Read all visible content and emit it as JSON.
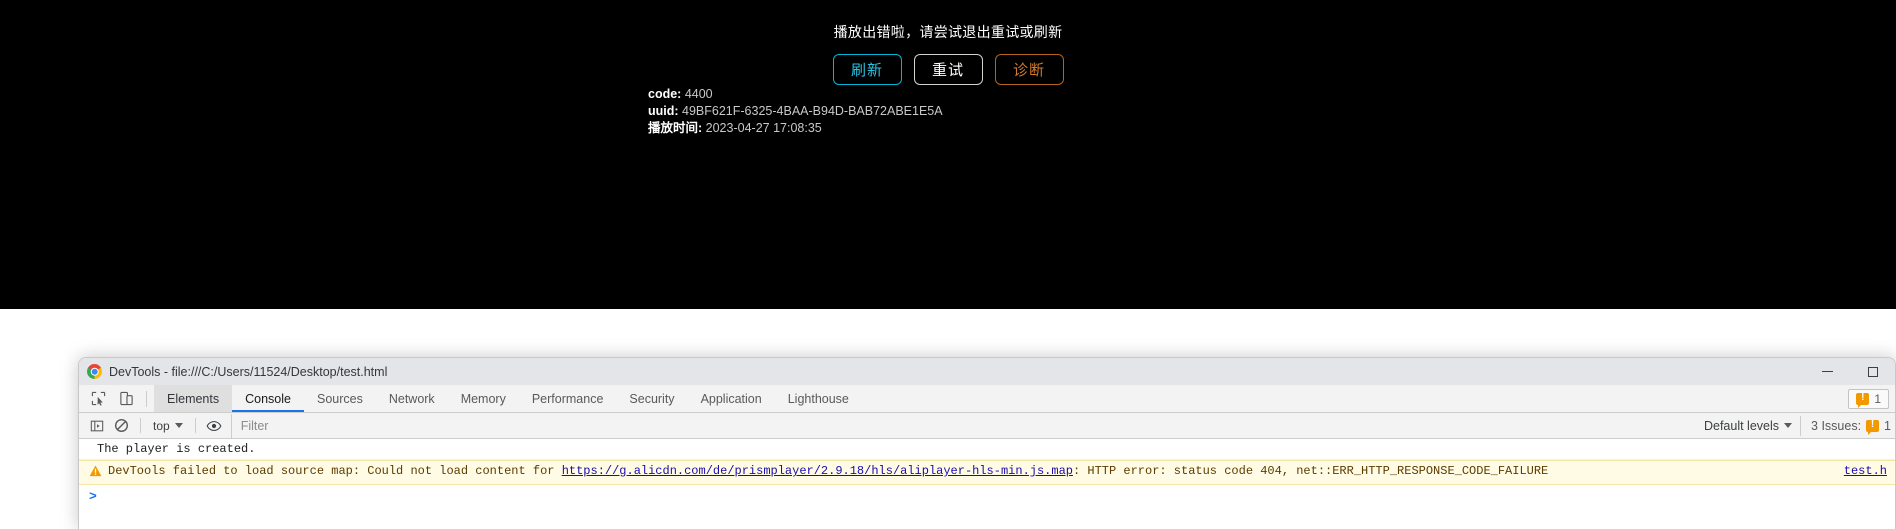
{
  "player": {
    "error_message": "播放出错啦，请尝试退出重试或刷新",
    "buttons": [
      {
        "label": "刷新",
        "name": "refresh",
        "color": "#29c2e3"
      },
      {
        "label": "重试",
        "name": "retry",
        "color": "#ffffff"
      },
      {
        "label": "诊断",
        "name": "diagnose",
        "color": "#d27b2c"
      }
    ],
    "info": [
      {
        "key": "code:",
        "value": "4400"
      },
      {
        "key": "uuid:",
        "value": "49BF621F-6325-4BAA-B94D-BAB72ABE1E5A"
      },
      {
        "key": "播放时间:",
        "value": "2023-04-27 17:08:35"
      }
    ]
  },
  "devtools": {
    "window_title": "DevTools - file:///C:/Users/11524/Desktop/test.html",
    "logo_icon": "chrome-logo-icon",
    "window_controls": [
      {
        "name": "minimize-button",
        "glyph": "minimize-icon"
      },
      {
        "name": "maximize-button",
        "glyph": "maximize-icon"
      }
    ],
    "tabbar": {
      "icons": [
        {
          "name": "inspect-element-icon"
        },
        {
          "name": "device-toolbar-icon"
        }
      ],
      "tabs": [
        {
          "label": "Elements",
          "state": "hovered"
        },
        {
          "label": "Console",
          "state": "active"
        },
        {
          "label": "Sources",
          "state": "normal"
        },
        {
          "label": "Network",
          "state": "normal"
        },
        {
          "label": "Memory",
          "state": "normal"
        },
        {
          "label": "Performance",
          "state": "normal"
        },
        {
          "label": "Security",
          "state": "normal"
        },
        {
          "label": "Application",
          "state": "normal"
        },
        {
          "label": "Lighthouse",
          "state": "normal"
        }
      ],
      "issue_chip": {
        "count": "1",
        "icon": "warning-icon"
      }
    },
    "toolbar": {
      "sidebar_toggle_icon": "console-sidebar-icon",
      "clear_console_icon": "clear-console-icon",
      "context": "top",
      "eye_icon": "live-expression-icon",
      "filter_placeholder": "Filter",
      "filter_value": "",
      "levels_label": "Default levels",
      "issues_label": "3 Issues:",
      "issues_count": "1"
    },
    "console": {
      "messages": [
        {
          "type": "log",
          "text": "The player is created.",
          "source": ""
        },
        {
          "type": "warning",
          "prefix": "DevTools failed to load source map: Could not load content for ",
          "link": "https://g.alicdn.com/de/prismplayer/2.9.18/hls/aliplayer-hls-min.js.map",
          "suffix": ": HTTP error: status code 404, net::ERR_HTTP_RESPONSE_CODE_FAILURE",
          "source": "test.h"
        }
      ],
      "prompt": ">"
    }
  },
  "colors": {
    "player_bg": "#000000",
    "accent_blue": "#1a73e8",
    "warning_amber": "#f29900",
    "warning_bg": "#fffbe5",
    "link": "#1a0dab"
  }
}
